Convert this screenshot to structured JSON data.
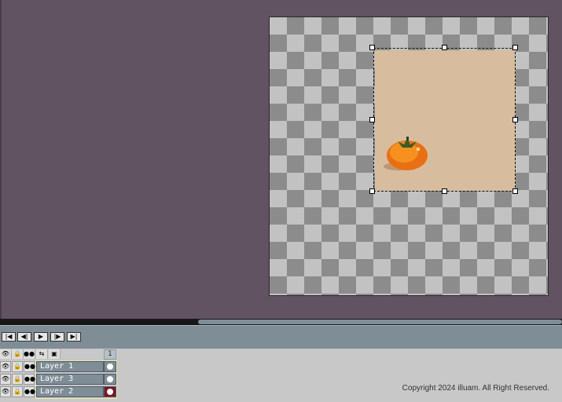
{
  "playback": {
    "first_frame_icon": "first-frame-icon",
    "prev_frame_icon": "prev-frame-icon",
    "play_icon": "play-icon",
    "next_frame_icon": "next-frame-icon",
    "last_frame_icon": "last-frame-icon"
  },
  "layer_header": {
    "columns": [
      "visibility-icon",
      "lock-icon",
      "link-icon",
      "reference-icon",
      "continuous-icon"
    ],
    "frame_number": "1"
  },
  "layers": [
    {
      "name": "Layer 1",
      "cel_color": "#7f8d97"
    },
    {
      "name": "Layer 3",
      "cel_color": "#7f8d97"
    },
    {
      "name": "Layer 2",
      "cel_color": "#7b1528"
    }
  ],
  "colors": {
    "workspace": "#615361",
    "selection_fill": "#d7bd9e",
    "persimmon": "#f07c1e",
    "timeline_accent": "#7f8d97"
  },
  "footer": {
    "copyright": "Copyright 2024 illuam. All Right Reserved."
  }
}
